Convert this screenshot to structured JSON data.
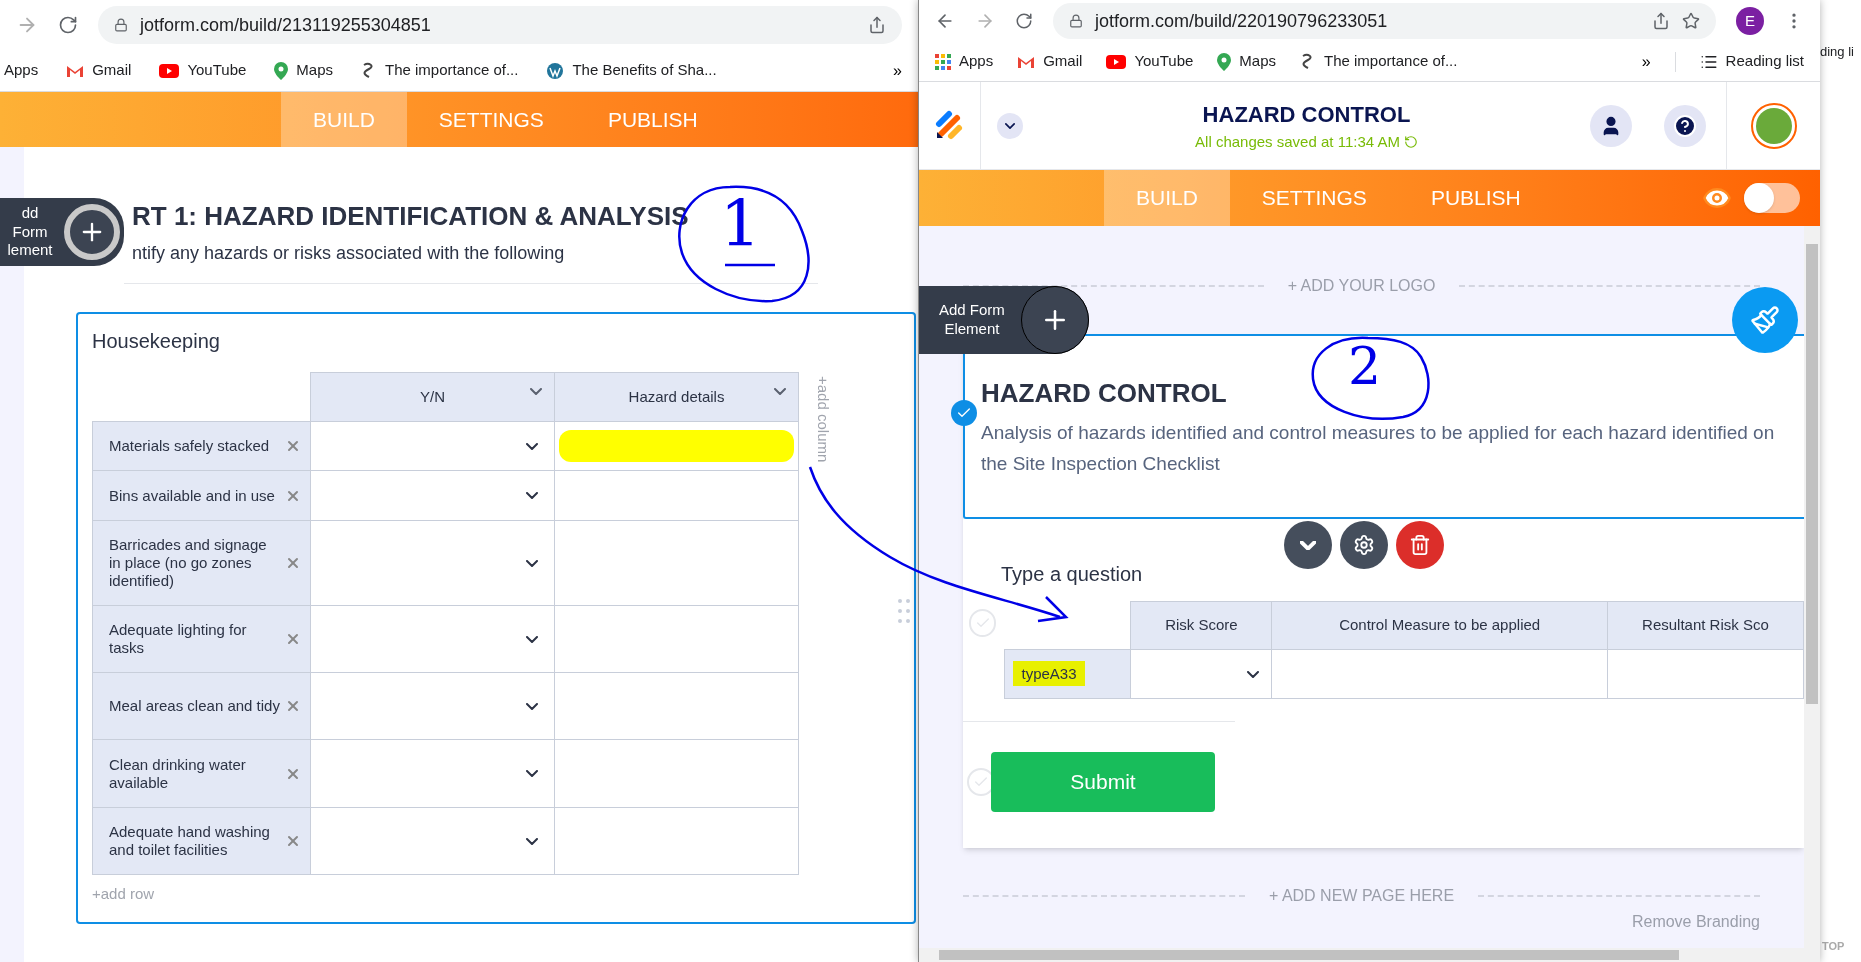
{
  "left_window": {
    "url": "jotform.com/build/213119255304851",
    "bookmarks": [
      {
        "label": "Apps",
        "kind": "none"
      },
      {
        "label": "Gmail",
        "kind": "gmail"
      },
      {
        "label": "YouTube",
        "kind": "youtube"
      },
      {
        "label": "Maps",
        "kind": "maps"
      },
      {
        "label": "The importance of...",
        "kind": "link"
      },
      {
        "label": "The Benefits of Sha...",
        "kind": "wordpress"
      }
    ],
    "more": "»",
    "nav_tabs": [
      {
        "label": "BUILD",
        "selected": true
      },
      {
        "label": "SETTINGS",
        "selected": false
      },
      {
        "label": "PUBLISH",
        "selected": false
      }
    ],
    "add_element": [
      "dd Form",
      "lement"
    ],
    "title": "RT 1: HAZARD IDENTIFICATION & ANALYSIS",
    "description": "ntify any hazards or risks associated with the following",
    "card": {
      "title": "Housekeeping",
      "columns": [
        "Y/N",
        "Hazard details"
      ],
      "rows": [
        {
          "label": "Materials safely stacked",
          "highlighted": true
        },
        {
          "label": "Bins available and in use",
          "highlighted": false
        },
        {
          "label": "Barricades and signage in place (no go zones identified)",
          "highlighted": false
        },
        {
          "label": "Adequate lighting for tasks",
          "highlighted": false
        },
        {
          "label": "Meal areas clean and tidy",
          "highlighted": false
        },
        {
          "label": "Clean drinking water available",
          "highlighted": false
        },
        {
          "label": "Adequate hand washing and toilet facilities",
          "highlighted": false
        }
      ],
      "add_row": "+add row",
      "add_column": "+add column"
    }
  },
  "right_window": {
    "url": "jotform.com/build/220190796233051",
    "profile": "E",
    "bookmarks": [
      {
        "label": "Apps",
        "kind": "apps"
      },
      {
        "label": "Gmail",
        "kind": "gmail"
      },
      {
        "label": "YouTube",
        "kind": "youtube"
      },
      {
        "label": "Maps",
        "kind": "maps"
      },
      {
        "label": "The importance of...",
        "kind": "link"
      }
    ],
    "more": "»",
    "reading_list": "Reading list",
    "form_title": "HAZARD CONTROL",
    "saved_status": "All changes saved at 11:34 AM",
    "nav_tabs": [
      {
        "label": "BUILD",
        "selected": true
      },
      {
        "label": "SETTINGS",
        "selected": false
      },
      {
        "label": "PUBLISH",
        "selected": false
      }
    ],
    "preview_on": false,
    "add_logo": "+ ADD YOUR LOGO",
    "add_element": [
      "Add Form",
      "Element"
    ],
    "heading": "HAZARD CONTROL",
    "heading_description": "Analysis of hazards identified and control measures to be applied for each hazard identified on the Site Inspection Checklist",
    "question": "Type a question",
    "columns": [
      "Risk Score",
      "Control Measure to be applied",
      "Resultant Risk Sco"
    ],
    "rows": [
      {
        "label": "typeA33",
        "highlighted": true
      }
    ],
    "submit": "Submit",
    "add_page": "+ ADD NEW PAGE HERE",
    "remove_branding": "Remove Branding"
  },
  "background_window": {
    "reading_list": "ding li",
    "scroll_top": "TOP"
  },
  "annotations": [
    {
      "label": "1"
    },
    {
      "label": "2"
    }
  ]
}
